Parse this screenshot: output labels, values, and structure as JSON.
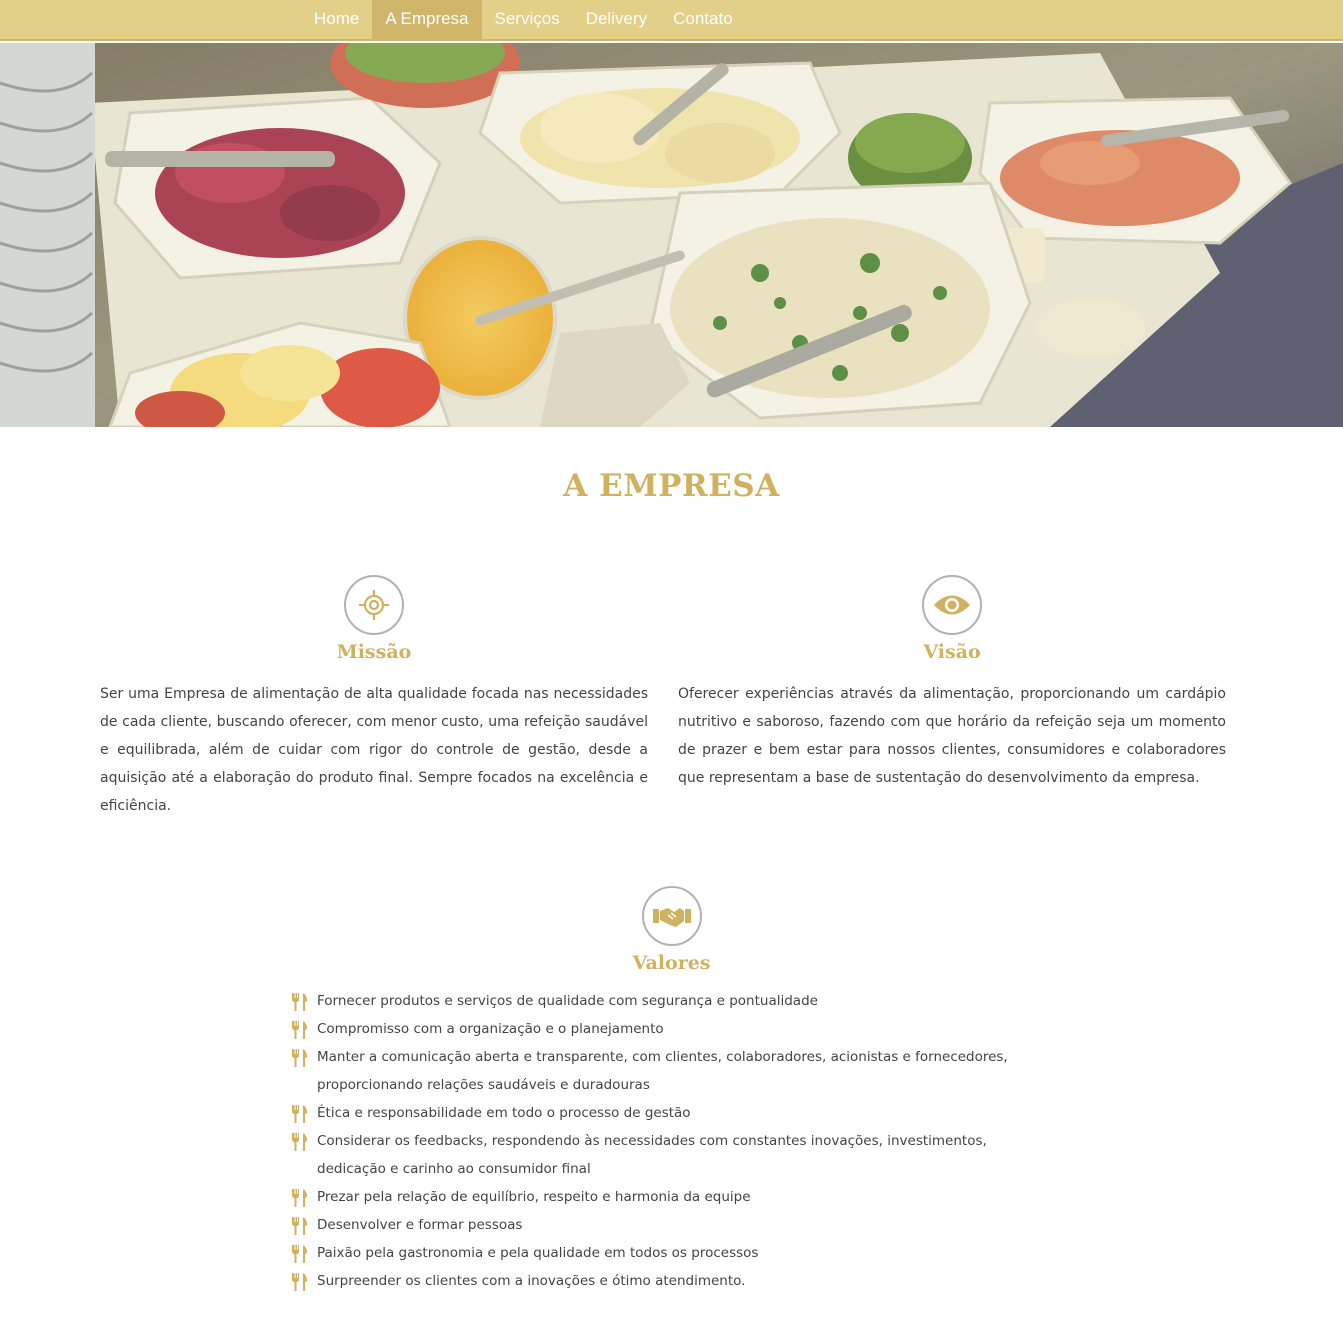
{
  "nav": {
    "items": [
      {
        "label": "Home",
        "active": false
      },
      {
        "label": "A Empresa",
        "active": true
      },
      {
        "label": "Serviços",
        "active": false
      },
      {
        "label": "Delivery",
        "active": false
      },
      {
        "label": "Contato",
        "active": false
      }
    ]
  },
  "page_title": "A EMPRESA",
  "missao": {
    "icon": "target-icon",
    "title": "Missão",
    "text": "Ser uma Empresa de alimentação de alta qualidade focada nas necessidades de cada cliente, buscando oferecer, com menor custo, uma refeição saudável e equilibrada, além de cuidar com rigor do controle de gestão, desde a aquisição até a elaboração do produto final. Sempre focados na excelência e eficiência."
  },
  "visao": {
    "icon": "eye-icon",
    "title": "Visão",
    "text": "Oferecer experiências através da alimentação, proporcionando um cardápio nutritivo e saboroso, fazendo com que horário da refeição seja um momento de prazer e bem estar para nossos clientes, consumidores e colaboradores que representam a base de sustentação do desenvolvimento da empresa."
  },
  "valores": {
    "icon": "handshake-icon",
    "title": "Valores",
    "items": [
      "Fornecer produtos e serviços de qualidade com segurança e pontualidade",
      "Compromisso com a organização e o planejamento",
      "Manter a comunicação aberta e transparente, com clientes, colaboradores, acionistas e fornecedores, proporcionando relações saudáveis e duradouras",
      "Ética e responsabilidade em todo o processo de gestão",
      "Considerar os feedbacks, respondendo às necessidades com constantes inovações, investimentos, dedicação e carinho ao consumidor final",
      "Prezar pela relação de equilíbrio, respeito e harmonia da equipe",
      "Desenvolver e formar pessoas",
      "Paixão pela gastronomia e pela qualidade em todos os processos",
      "Surpreender os clientes com a inovações e ótimo atendimento."
    ]
  },
  "colors": {
    "nav_bg": "#e2cf88",
    "nav_active": "#cfb66a",
    "accent": "#cfb15f",
    "text": "#444444"
  }
}
